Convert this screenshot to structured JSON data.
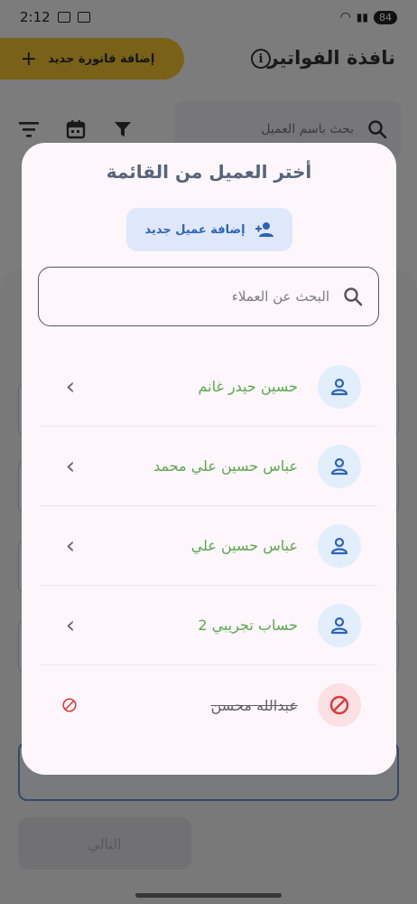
{
  "status_bar": {
    "time": "2:12",
    "battery": "84"
  },
  "header": {
    "title": "نافذة الفواتير",
    "add_invoice_label": "إضافة فاتورة جديد"
  },
  "background_search": {
    "placeholder": "بحث باسم العميل"
  },
  "background_sheet": {
    "next_label": "التالي"
  },
  "dialog": {
    "title": "أختر العميل من القائمة",
    "add_client_label": "إضافة عميل جديد",
    "search_placeholder": "البحث عن العملاء",
    "clients": [
      {
        "name": "حسين حيدر غانم",
        "status": "active"
      },
      {
        "name": "عباس حسين علي محمد",
        "status": "active"
      },
      {
        "name": "عباس حسين علي",
        "status": "active"
      },
      {
        "name": "حساب تجريبي 2",
        "status": "active"
      },
      {
        "name": "عبدالله محسن",
        "status": "blocked"
      }
    ]
  },
  "colors": {
    "accent_yellow": "#f2c530",
    "primary_blue": "#2d64b9",
    "client_name_green": "#5aa84d",
    "blocked_red": "#d93a3a",
    "dialog_bg": "#fdf6fb"
  }
}
